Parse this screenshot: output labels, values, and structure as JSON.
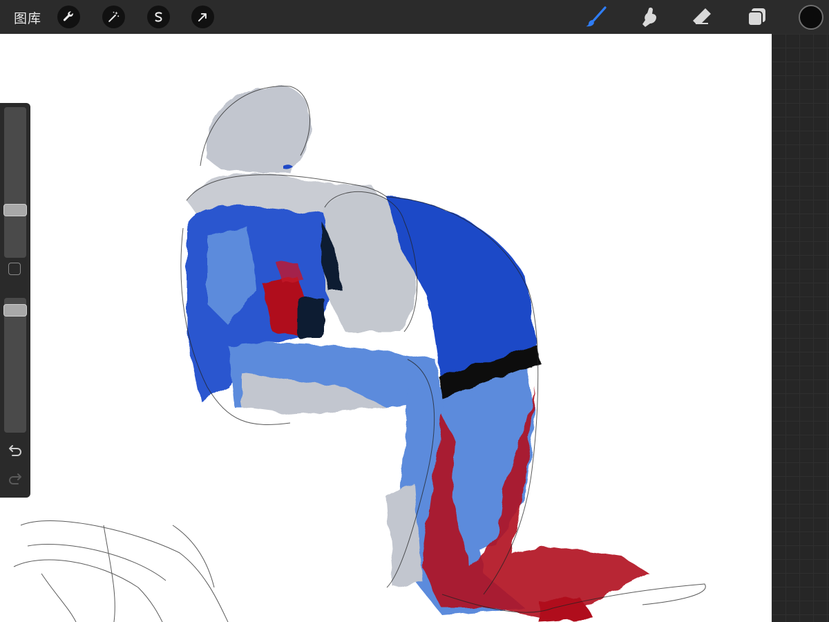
{
  "toolbar": {
    "gallery_label": "图库",
    "actions_icon": "wrench-icon",
    "adjustments_icon": "magic-wand-icon",
    "selection_icon": "selection-s-icon",
    "transform_icon": "arrow-cursor-icon",
    "brush_icon": "brush-icon",
    "smudge_icon": "smudge-finger-icon",
    "eraser_icon": "eraser-icon",
    "layers_icon": "layers-icon",
    "active_tool": "brush",
    "accent_color": "#2f7df6",
    "current_color": "#0b0b0b"
  },
  "sidebar": {
    "brush_size_level": 0.3,
    "opacity_level": 0.95,
    "modifier_icon": "square-modifier-icon",
    "undo_icon": "undo-icon",
    "redo_icon": "redo-icon"
  },
  "canvas": {
    "background": "#ffffff",
    "palette": [
      "#1f49c7",
      "#5b8bdc",
      "#c2c6cf",
      "#b0101f",
      "#0b1a33"
    ]
  }
}
